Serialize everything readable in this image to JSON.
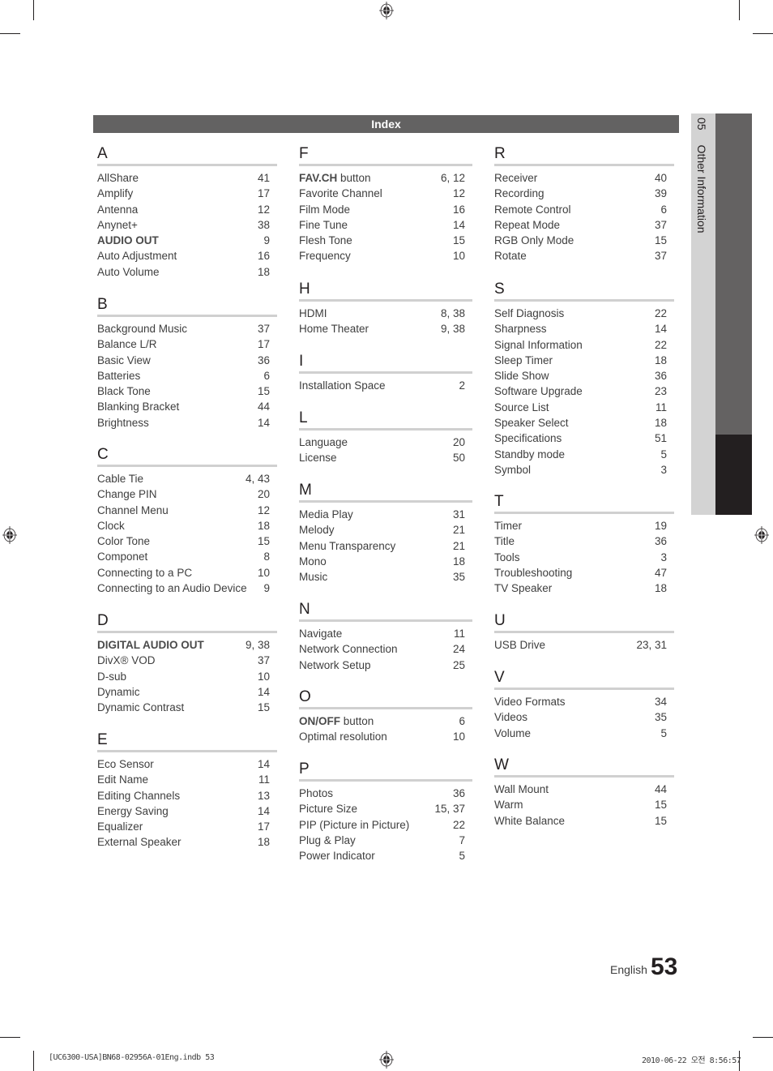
{
  "header": {
    "title": "Index"
  },
  "side_tab": {
    "chapter_number": "05",
    "chapter_title": "Other Information"
  },
  "columns": [
    {
      "sections": [
        {
          "letter": "A",
          "entries": [
            {
              "term": "AllShare",
              "bold": "",
              "page": "41"
            },
            {
              "term": "Amplify",
              "bold": "",
              "page": "17"
            },
            {
              "term": "Antenna",
              "bold": "",
              "page": "12"
            },
            {
              "term": "Anynet+",
              "bold": "",
              "page": "38"
            },
            {
              "term": "",
              "bold": "AUDIO OUT",
              "page": "9"
            },
            {
              "term": "Auto Adjustment",
              "bold": "",
              "page": "16"
            },
            {
              "term": "Auto Volume",
              "bold": "",
              "page": "18"
            }
          ]
        },
        {
          "letter": "B",
          "entries": [
            {
              "term": "Background Music",
              "bold": "",
              "page": "37"
            },
            {
              "term": "Balance L/R",
              "bold": "",
              "page": "17"
            },
            {
              "term": "Basic View",
              "bold": "",
              "page": "36"
            },
            {
              "term": "Batteries",
              "bold": "",
              "page": "6"
            },
            {
              "term": "Black Tone",
              "bold": "",
              "page": "15"
            },
            {
              "term": "Blanking Bracket",
              "bold": "",
              "page": "44"
            },
            {
              "term": "Brightness",
              "bold": "",
              "page": "14"
            }
          ]
        },
        {
          "letter": "C",
          "entries": [
            {
              "term": "Cable Tie",
              "bold": "",
              "page": "4, 43"
            },
            {
              "term": "Change PIN",
              "bold": "",
              "page": "20"
            },
            {
              "term": "Channel Menu",
              "bold": "",
              "page": "12"
            },
            {
              "term": "Clock",
              "bold": "",
              "page": "18"
            },
            {
              "term": "Color Tone",
              "bold": "",
              "page": "15"
            },
            {
              "term": "Componet",
              "bold": "",
              "page": "8"
            },
            {
              "term": "Connecting to a PC",
              "bold": "",
              "page": "10"
            },
            {
              "term": "Connecting to an Audio Device",
              "bold": "",
              "page": "9"
            }
          ]
        },
        {
          "letter": "D",
          "entries": [
            {
              "term": "",
              "bold": "DIGITAL AUDIO OUT",
              "page": "9, 38"
            },
            {
              "term": "DivX® VOD",
              "bold": "",
              "page": "37"
            },
            {
              "term": "D-sub",
              "bold": "",
              "page": "10"
            },
            {
              "term": "Dynamic",
              "bold": "",
              "page": "14"
            },
            {
              "term": "Dynamic Contrast",
              "bold": "",
              "page": "15"
            }
          ]
        },
        {
          "letter": "E",
          "entries": [
            {
              "term": "Eco Sensor",
              "bold": "",
              "page": "14"
            },
            {
              "term": "Edit Name",
              "bold": "",
              "page": "11"
            },
            {
              "term": "Editing Channels",
              "bold": "",
              "page": "13"
            },
            {
              "term": "Energy Saving",
              "bold": "",
              "page": "14"
            },
            {
              "term": "Equalizer",
              "bold": "",
              "page": "17"
            },
            {
              "term": "External Speaker",
              "bold": "",
              "page": "18"
            }
          ]
        }
      ]
    },
    {
      "sections": [
        {
          "letter": "F",
          "entries": [
            {
              "term": " button",
              "bold": "FAV.CH",
              "page": "6, 12"
            },
            {
              "term": "Favorite Channel",
              "bold": "",
              "page": "12"
            },
            {
              "term": "Film Mode",
              "bold": "",
              "page": "16"
            },
            {
              "term": "Fine Tune",
              "bold": "",
              "page": "14"
            },
            {
              "term": "Flesh Tone",
              "bold": "",
              "page": "15"
            },
            {
              "term": "Frequency",
              "bold": "",
              "page": "10"
            }
          ]
        },
        {
          "letter": "H",
          "entries": [
            {
              "term": "HDMI",
              "bold": "",
              "page": "8, 38"
            },
            {
              "term": "Home Theater",
              "bold": "",
              "page": "9, 38"
            }
          ]
        },
        {
          "letter": "I",
          "entries": [
            {
              "term": "Installation Space",
              "bold": "",
              "page": "2"
            }
          ]
        },
        {
          "letter": "L",
          "entries": [
            {
              "term": "Language",
              "bold": "",
              "page": "20"
            },
            {
              "term": "License",
              "bold": "",
              "page": "50"
            }
          ]
        },
        {
          "letter": "M",
          "entries": [
            {
              "term": "Media Play",
              "bold": "",
              "page": "31"
            },
            {
              "term": "Melody",
              "bold": "",
              "page": "21"
            },
            {
              "term": "Menu Transparency",
              "bold": "",
              "page": "21"
            },
            {
              "term": "Mono",
              "bold": "",
              "page": "18"
            },
            {
              "term": "Music",
              "bold": "",
              "page": "35"
            }
          ]
        },
        {
          "letter": "N",
          "entries": [
            {
              "term": "Navigate",
              "bold": "",
              "page": "11"
            },
            {
              "term": "Network Connection",
              "bold": "",
              "page": "24"
            },
            {
              "term": "Network Setup",
              "bold": "",
              "page": "25"
            }
          ]
        },
        {
          "letter": "O",
          "entries": [
            {
              "term": " button",
              "bold": "ON/OFF",
              "page": "6"
            },
            {
              "term": "Optimal resolution",
              "bold": "",
              "page": "10"
            }
          ]
        },
        {
          "letter": "P",
          "entries": [
            {
              "term": "Photos",
              "bold": "",
              "page": "36"
            },
            {
              "term": "Picture Size",
              "bold": "",
              "page": "15, 37"
            },
            {
              "term": "PIP (Picture in Picture)",
              "bold": "",
              "page": "22"
            },
            {
              "term": "Plug & Play",
              "bold": "",
              "page": "7"
            },
            {
              "term": "Power Indicator",
              "bold": "",
              "page": "5"
            }
          ]
        }
      ]
    },
    {
      "sections": [
        {
          "letter": "R",
          "entries": [
            {
              "term": "Receiver",
              "bold": "",
              "page": "40"
            },
            {
              "term": "Recording",
              "bold": "",
              "page": "39"
            },
            {
              "term": "Remote Control",
              "bold": "",
              "page": "6"
            },
            {
              "term": "Repeat Mode",
              "bold": "",
              "page": "37"
            },
            {
              "term": "RGB Only Mode",
              "bold": "",
              "page": "15"
            },
            {
              "term": "Rotate",
              "bold": "",
              "page": "37"
            }
          ]
        },
        {
          "letter": "S",
          "entries": [
            {
              "term": "Self Diagnosis",
              "bold": "",
              "page": "22"
            },
            {
              "term": "Sharpness",
              "bold": "",
              "page": "14"
            },
            {
              "term": "Signal Information",
              "bold": "",
              "page": "22"
            },
            {
              "term": "Sleep Timer",
              "bold": "",
              "page": "18"
            },
            {
              "term": "Slide Show",
              "bold": "",
              "page": "36"
            },
            {
              "term": "Software Upgrade",
              "bold": "",
              "page": "23"
            },
            {
              "term": "Source List",
              "bold": "",
              "page": "11"
            },
            {
              "term": "Speaker Select",
              "bold": "",
              "page": "18"
            },
            {
              "term": "Specifications",
              "bold": "",
              "page": "51"
            },
            {
              "term": "Standby mode",
              "bold": "",
              "page": "5"
            },
            {
              "term": "Symbol",
              "bold": "",
              "page": "3"
            }
          ]
        },
        {
          "letter": "T",
          "entries": [
            {
              "term": "Timer",
              "bold": "",
              "page": "19"
            },
            {
              "term": "Title",
              "bold": "",
              "page": "36"
            },
            {
              "term": "Tools",
              "bold": "",
              "page": "3"
            },
            {
              "term": "Troubleshooting",
              "bold": "",
              "page": "47"
            },
            {
              "term": "TV Speaker",
              "bold": "",
              "page": "18"
            }
          ]
        },
        {
          "letter": "U",
          "entries": [
            {
              "term": "USB Drive",
              "bold": "",
              "page": "23, 31"
            }
          ]
        },
        {
          "letter": "V",
          "entries": [
            {
              "term": "Video Formats",
              "bold": "",
              "page": "34"
            },
            {
              "term": "Videos",
              "bold": "",
              "page": "35"
            },
            {
              "term": "Volume",
              "bold": "",
              "page": "5"
            }
          ]
        },
        {
          "letter": "W",
          "entries": [
            {
              "term": "Wall Mount",
              "bold": "",
              "page": "44"
            },
            {
              "term": "Warm",
              "bold": "",
              "page": "15"
            },
            {
              "term": "White Balance",
              "bold": "",
              "page": "15"
            }
          ]
        }
      ]
    }
  ],
  "footer": {
    "language": "English",
    "page_number": "53",
    "slug_left": "[UC6300-USA]BN68-02956A-01Eng.indb   53",
    "slug_right": "2010-06-22   오전 8:56:57"
  }
}
